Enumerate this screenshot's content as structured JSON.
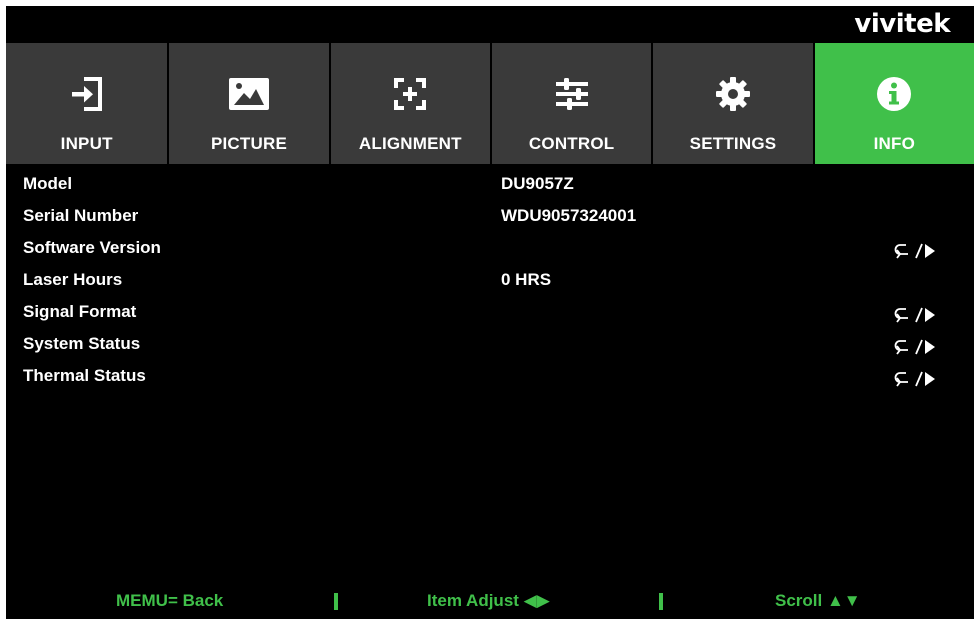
{
  "brand": "vivitek",
  "tabs": [
    {
      "label": "INPUT",
      "icon": "input-icon",
      "active": false
    },
    {
      "label": "PICTURE",
      "icon": "picture-icon",
      "active": false
    },
    {
      "label": "ALIGNMENT",
      "icon": "alignment-icon",
      "active": false
    },
    {
      "label": "CONTROL",
      "icon": "sliders-icon",
      "active": false
    },
    {
      "label": "SETTINGS",
      "icon": "gear-icon",
      "active": false
    },
    {
      "label": "INFO",
      "icon": "info-icon",
      "active": true
    }
  ],
  "rows": [
    {
      "name": "Model",
      "value": "DU9057Z"
    },
    {
      "name": "Serial Number",
      "value": "WDU9057324001"
    },
    {
      "name": "Software Version",
      "value": ""
    },
    {
      "name": "Laser Hours",
      "value": "0 HRS"
    },
    {
      "name": "Signal Format",
      "value": ""
    },
    {
      "name": "System Status",
      "value": ""
    },
    {
      "name": "Thermal Status",
      "value": ""
    }
  ],
  "footer": {
    "back": "MEMU= Back",
    "adjust": "Item Adjust ◀▶",
    "scroll": "Scroll ▲▼"
  },
  "colors": {
    "accent": "#40c04a",
    "tab_bg": "#3a3a3a",
    "background": "#000000"
  }
}
